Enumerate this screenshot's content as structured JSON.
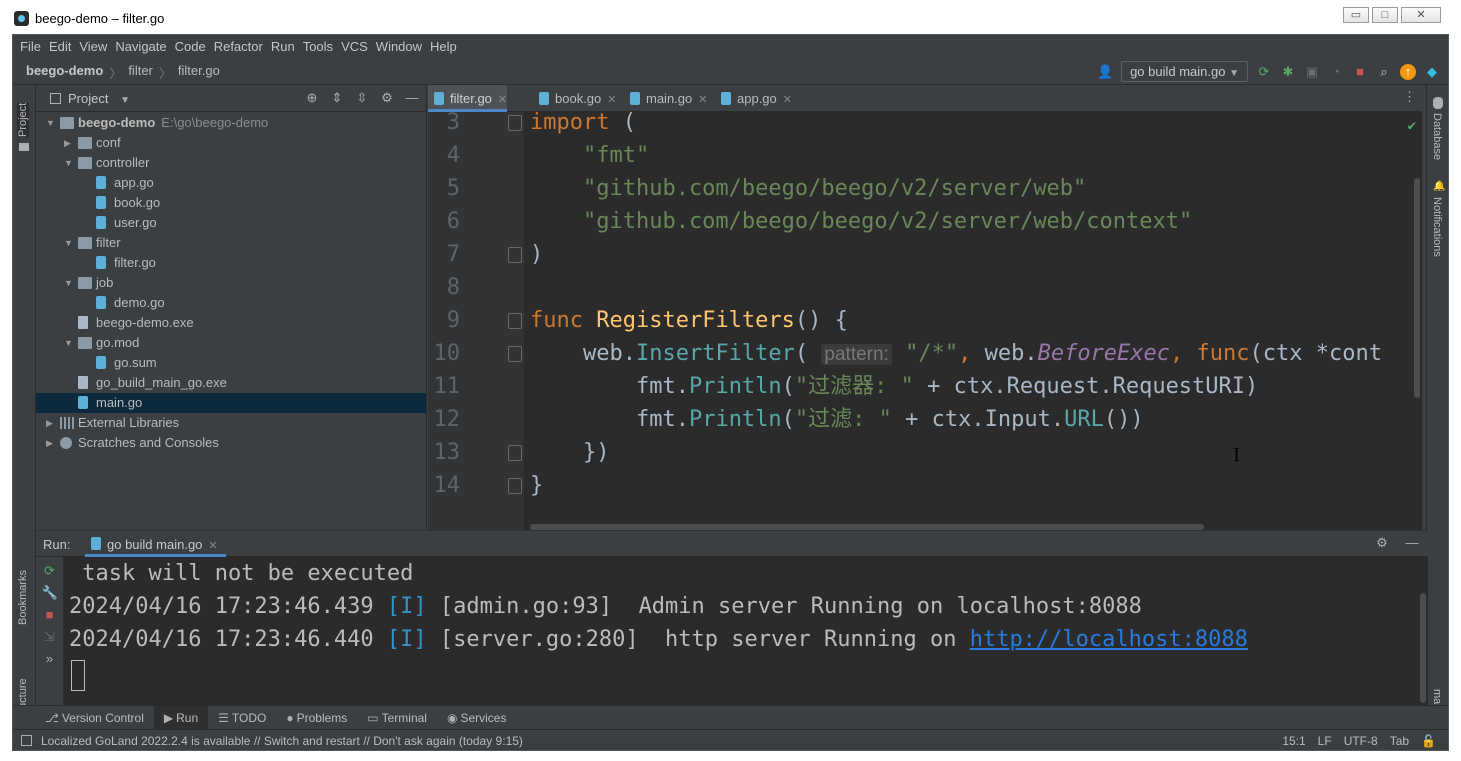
{
  "window": {
    "title": "beego-demo – filter.go",
    "min": "▭",
    "max": "□",
    "close": "✕"
  },
  "menu": [
    "File",
    "Edit",
    "View",
    "Navigate",
    "Code",
    "Refactor",
    "Run",
    "Tools",
    "VCS",
    "Window",
    "Help"
  ],
  "breadcrumb": {
    "project": "beego-demo",
    "folder": "filter",
    "file": "filter.go",
    "sep": "〉"
  },
  "toolbar": {
    "run_config": "go build main.go",
    "icons": [
      "user-icon",
      "run-icon",
      "debug-icon",
      "coverage-icon",
      "profile-icon",
      "stop-icon",
      "search-icon",
      "update-icon",
      "goland-icon"
    ]
  },
  "left_strip": {
    "project": "Project",
    "bookmarks": "Bookmarks",
    "structure": "Structure"
  },
  "right_strip": {
    "database": "Database",
    "notifications": "Notifications",
    "make": "make"
  },
  "project_panel": {
    "title": "Project",
    "tree": [
      {
        "label": "beego-demo",
        "path": "E:\\go\\beego-demo",
        "indent": 0,
        "type": "folder",
        "open": true
      },
      {
        "label": "conf",
        "indent": 1,
        "type": "folder",
        "open": false
      },
      {
        "label": "controller",
        "indent": 1,
        "type": "folder",
        "open": true
      },
      {
        "label": "app.go",
        "indent": 2,
        "type": "go"
      },
      {
        "label": "book.go",
        "indent": 2,
        "type": "go"
      },
      {
        "label": "user.go",
        "indent": 2,
        "type": "go"
      },
      {
        "label": "filter",
        "indent": 1,
        "type": "folder",
        "open": true
      },
      {
        "label": "filter.go",
        "indent": 2,
        "type": "go"
      },
      {
        "label": "job",
        "indent": 1,
        "type": "folder",
        "open": true
      },
      {
        "label": "demo.go",
        "indent": 2,
        "type": "go"
      },
      {
        "label": "beego-demo.exe",
        "indent": 1,
        "type": "exe"
      },
      {
        "label": "go.mod",
        "indent": 1,
        "type": "folder",
        "open": true
      },
      {
        "label": "go.sum",
        "indent": 2,
        "type": "go"
      },
      {
        "label": "go_build_main_go.exe",
        "indent": 1,
        "type": "exe"
      },
      {
        "label": "main.go",
        "indent": 1,
        "type": "go",
        "selected": true
      },
      {
        "label": "External Libraries",
        "indent": 0,
        "type": "lib",
        "open": false
      },
      {
        "label": "Scratches and Consoles",
        "indent": 0,
        "type": "scratch",
        "open": false
      }
    ]
  },
  "editor": {
    "tabs": [
      {
        "label": "filter.go",
        "active": true
      },
      {
        "label": "book.go"
      },
      {
        "label": "main.go"
      },
      {
        "label": "app.go"
      }
    ],
    "lines": [
      {
        "n": "3",
        "fold": true,
        "parts": [
          [
            "kw",
            "import"
          ],
          [
            "",
            " ("
          ]
        ]
      },
      {
        "n": "4",
        "parts": [
          [
            "str",
            "    \"fmt\""
          ]
        ]
      },
      {
        "n": "5",
        "parts": [
          [
            "str",
            "    \"github.com/beego/beego/v2/server/web\""
          ]
        ]
      },
      {
        "n": "6",
        "parts": [
          [
            "str",
            "    \"github.com/beego/beego/v2/server/web/context\""
          ]
        ]
      },
      {
        "n": "7",
        "fold": true,
        "parts": [
          [
            "",
            ")"
          ]
        ]
      },
      {
        "n": "8",
        "parts": []
      },
      {
        "n": "9",
        "fold": true,
        "parts": [
          [
            "kw",
            "func "
          ],
          [
            "fn",
            "RegisterFilters"
          ],
          [
            "",
            "() {"
          ]
        ]
      },
      {
        "n": "10",
        "fold": true,
        "parts": [
          [
            "",
            "    web."
          ],
          [
            "call",
            "InsertFilter"
          ],
          [
            "",
            "( "
          ],
          [
            "hint",
            "pattern:"
          ],
          [
            "str",
            " \"/*\""
          ],
          [
            "kw",
            ", "
          ],
          [
            "",
            "web."
          ],
          [
            "ital",
            "BeforeExec"
          ],
          [
            "kw",
            ", func"
          ],
          [
            "",
            "(ctx *cont"
          ]
        ]
      },
      {
        "n": "11",
        "parts": [
          [
            "",
            "        fmt."
          ],
          [
            "call",
            "Println"
          ],
          [
            "",
            "("
          ],
          [
            "str",
            "\"过滤器: \""
          ],
          [
            "",
            " + ctx.Request.RequestURI)"
          ]
        ]
      },
      {
        "n": "12",
        "parts": [
          [
            "",
            "        fmt."
          ],
          [
            "call",
            "Println"
          ],
          [
            "",
            "("
          ],
          [
            "str",
            "\"过滤: \""
          ],
          [
            "",
            " + ctx.Input."
          ],
          [
            "call",
            "URL"
          ],
          [
            "",
            "())"
          ]
        ]
      },
      {
        "n": "13",
        "fold": true,
        "parts": [
          [
            "",
            "    })"
          ]
        ]
      },
      {
        "n": "14",
        "fold": true,
        "parts": [
          [
            "",
            "}"
          ]
        ]
      }
    ]
  },
  "run_panel": {
    "label": "Run:",
    "tab": "go build main.go",
    "console": [
      {
        "text": " task will not be executed"
      },
      {
        "pre": "2024/04/16 17:23:46.439 ",
        "lvl": "[I]",
        "post": " [admin.go:93]  Admin server Running on localhost:8088"
      },
      {
        "pre": "2024/04/16 17:23:46.440 ",
        "lvl": "[I]",
        "post": " [server.go:280]  http server Running on ",
        "link": "http://localhost:8088"
      }
    ]
  },
  "bottom_tabs": [
    {
      "label": "Version Control",
      "icon": "⎇"
    },
    {
      "label": "Run",
      "icon": "▶",
      "active": true
    },
    {
      "label": "TODO",
      "icon": "☰"
    },
    {
      "label": "Problems",
      "icon": "●"
    },
    {
      "label": "Terminal",
      "icon": "▭"
    },
    {
      "label": "Services",
      "icon": "◉"
    }
  ],
  "status_bar": {
    "message": "Localized GoLand 2022.2.4 is available // Switch and restart // Don't ask again (today 9:15)",
    "position": "15:1",
    "line_sep": "LF",
    "encoding": "UTF-8",
    "indent": "Tab"
  }
}
